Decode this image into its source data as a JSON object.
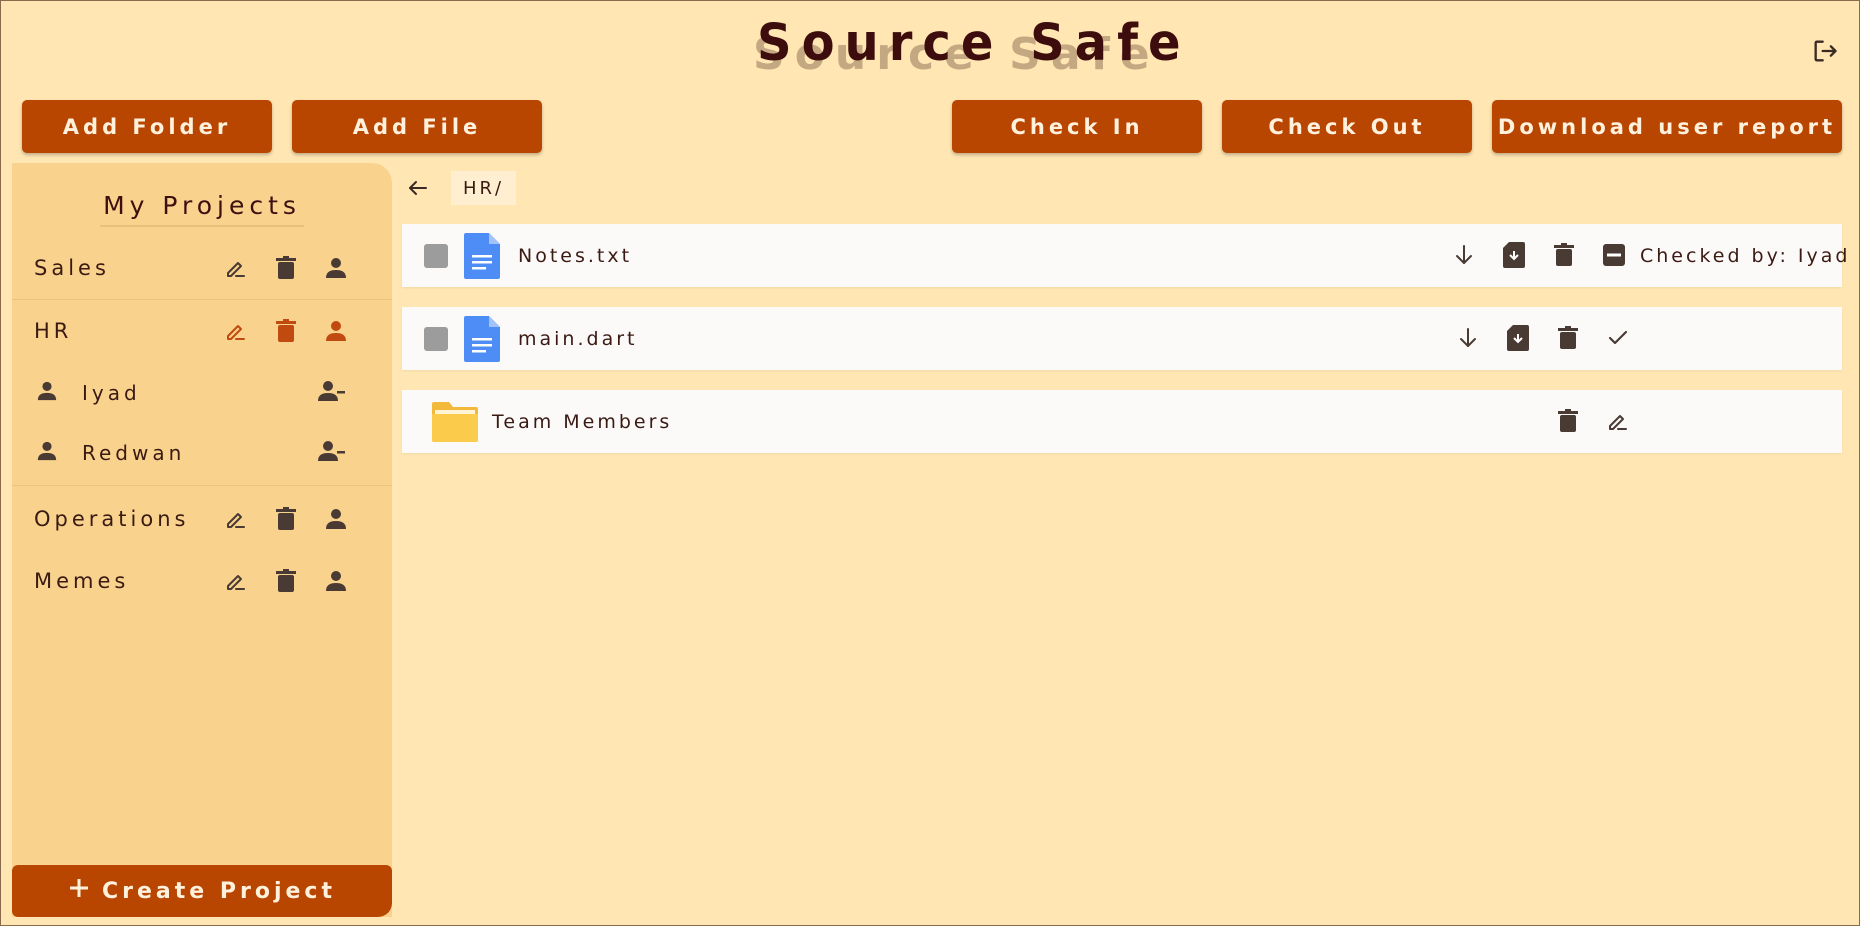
{
  "app": {
    "title": "Source Safe",
    "logout_icon": "logout-icon"
  },
  "toolbar": {
    "add_folder": "Add Folder",
    "add_file": "Add File",
    "check_in": "Check In",
    "check_out": "Check Out",
    "download_report": "Download user report"
  },
  "sidebar": {
    "title": "My Projects",
    "projects": [
      {
        "label": "Sales"
      },
      {
        "label": "HR",
        "members": [
          "Iyad",
          "Redwan"
        ]
      },
      {
        "label": "Operations"
      },
      {
        "label": "Memes"
      }
    ],
    "create_label": "Create Project"
  },
  "main": {
    "path": "HR/",
    "items": [
      {
        "type": "file",
        "name": "Notes.txt",
        "status": "Checked by: Iyad"
      },
      {
        "type": "file",
        "name": "main.dart",
        "status": ""
      },
      {
        "type": "folder",
        "name": "Team Members"
      }
    ]
  },
  "colors": {
    "background": "#FFE6B3",
    "sidebar": "#F9D38D",
    "accent": "#B84500",
    "active_icon": "#C04A10",
    "icon": "#4a3a34"
  }
}
